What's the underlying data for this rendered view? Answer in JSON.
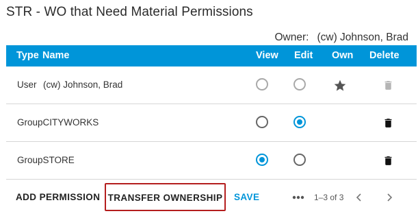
{
  "dialog": {
    "title": "STR - WO that Need Material Permissions",
    "owner_label": "Owner:",
    "owner_value": "(cw) Johnson, Brad"
  },
  "table": {
    "headers": {
      "type": "Type",
      "name": "Name",
      "view": "View",
      "edit": "Edit",
      "own": "Own",
      "delete": "Delete"
    },
    "rows": [
      {
        "type": "User",
        "name": "(cw) Johnson, Brad",
        "view": false,
        "edit": false,
        "own": true,
        "disabled": true
      },
      {
        "type": "",
        "name": "GroupCITYWORKS",
        "view": false,
        "edit": true,
        "own": false,
        "disabled": false
      },
      {
        "type": "",
        "name": "GroupSTORE",
        "view": true,
        "edit": false,
        "own": false,
        "disabled": false
      }
    ]
  },
  "footer": {
    "add_permission": "ADD PERMISSION",
    "transfer_ownership": "TRANSFER OWNERSHIP",
    "save": "SAVE",
    "more_icon": "more-horizontal-icon",
    "paging": "1–3 of 3"
  },
  "colors": {
    "header_bg": "#0095d9",
    "accent": "#0095d9",
    "highlight_border": "#b41d1d"
  }
}
